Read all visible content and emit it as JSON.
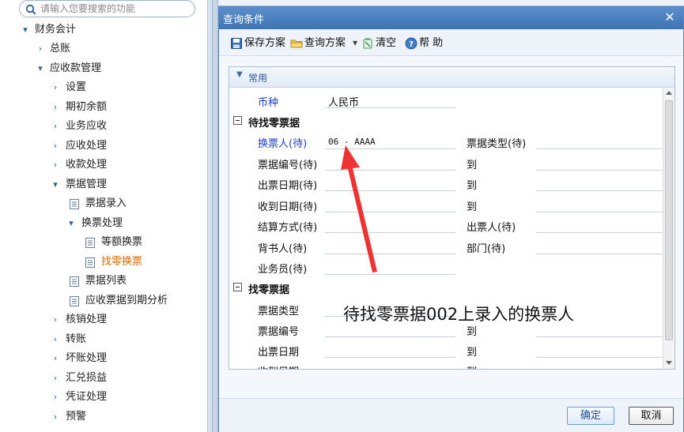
{
  "search": {
    "placeholder": "请输入您要搜索的功能"
  },
  "sidebar": {
    "items": [
      {
        "label": "财务会计",
        "state": "expanded"
      },
      {
        "label": "总账",
        "state": "collapsed"
      },
      {
        "label": "应收款管理",
        "state": "expanded"
      },
      {
        "label": "设置",
        "state": "collapsed"
      },
      {
        "label": "期初余额",
        "state": "collapsed"
      },
      {
        "label": "业务应收",
        "state": "collapsed"
      },
      {
        "label": "应收处理",
        "state": "collapsed"
      },
      {
        "label": "收款处理",
        "state": "collapsed"
      },
      {
        "label": "票据管理",
        "state": "expanded"
      },
      {
        "label": "票据录入",
        "state": "leaf"
      },
      {
        "label": "换票处理",
        "state": "expanded"
      },
      {
        "label": "等额换票",
        "state": "leaf"
      },
      {
        "label": "找零换票",
        "state": "leaf-active"
      },
      {
        "label": "票据列表",
        "state": "leaf"
      },
      {
        "label": "应收票据到期分析",
        "state": "leaf"
      },
      {
        "label": "核销处理",
        "state": "collapsed"
      },
      {
        "label": "转账",
        "state": "collapsed"
      },
      {
        "label": "坏账处理",
        "state": "collapsed"
      },
      {
        "label": "汇兑损益",
        "state": "collapsed"
      },
      {
        "label": "凭证处理",
        "state": "collapsed"
      },
      {
        "label": "预警",
        "state": "collapsed"
      }
    ]
  },
  "dialog": {
    "title": "查询条件",
    "toolbar": {
      "save_scheme": "保存方案",
      "query_scheme": "查询方案",
      "clear": "清空",
      "help": "帮 助"
    },
    "panel_title": "常用",
    "currency": {
      "label": "币种",
      "value": "人民币"
    },
    "section_pending": {
      "title": "待找零票据",
      "exchanger": {
        "label": "换票人(待)",
        "value": "06 - AAAA"
      },
      "bill_type_pending": "票据类型(待)",
      "bill_no": "票据编号(待)",
      "issue_date": "出票日期(待)",
      "receive_date": "收到日期(待)",
      "settle_method": "结算方式(待)",
      "drawer": "出票人(待)",
      "endorser": "背书人(待)",
      "dept": "部门(待)",
      "salesman": "业务员(待)",
      "to": "到"
    },
    "section_change": {
      "title": "找零票据",
      "bill_type": "票据类型",
      "bill_no": "票据编号",
      "issue_date": "出票日期",
      "receive_date": "收到日期",
      "to": "到"
    },
    "annotation": "待找零票据002上录入的换票人",
    "buttons": {
      "ok": "确定",
      "cancel": "取消"
    }
  },
  "colors": {
    "title_bar": "#3f73b4",
    "accent_blue": "#1f3fc8",
    "active_item": "#e06a00",
    "annotation_arrow": "#ee3333"
  }
}
